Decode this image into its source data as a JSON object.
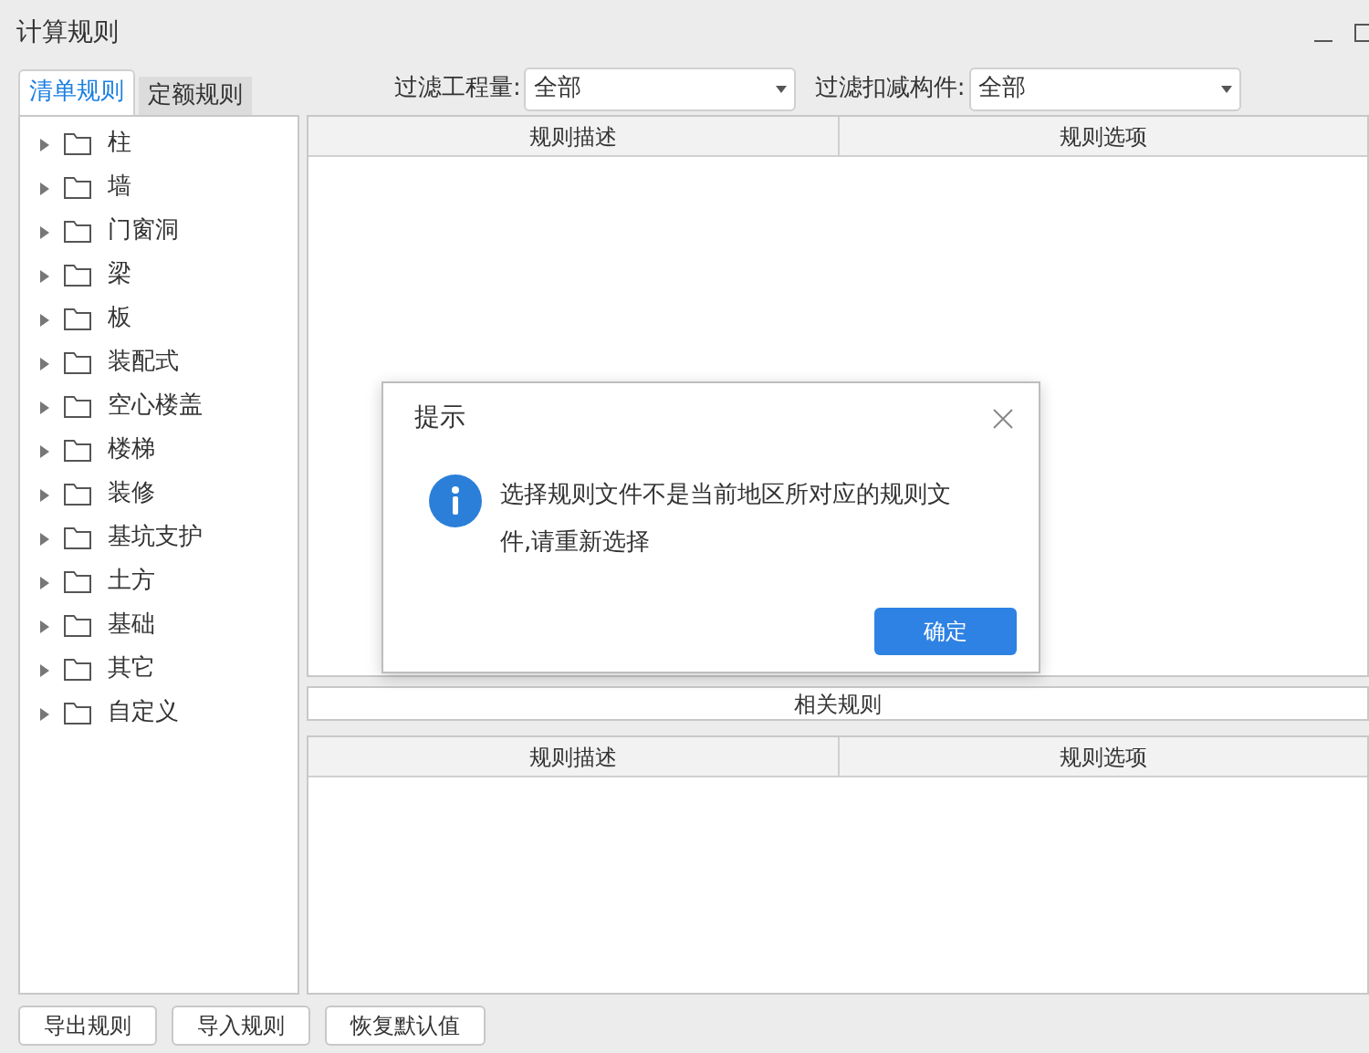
{
  "window": {
    "title": "计算规则"
  },
  "tabs": [
    {
      "label": "清单规则",
      "selected": true
    },
    {
      "label": "定额规则",
      "selected": false
    }
  ],
  "filters": [
    {
      "label": "过滤工程量:",
      "value": "全部"
    },
    {
      "label": "过滤扣减构件:",
      "value": "全部"
    }
  ],
  "tree": {
    "items": [
      {
        "label": "柱",
        "expanded": false
      },
      {
        "label": "墙",
        "expanded": false
      },
      {
        "label": "门窗洞",
        "expanded": false
      },
      {
        "label": "梁",
        "expanded": false
      },
      {
        "label": "板",
        "expanded": false
      },
      {
        "label": "装配式",
        "expanded": false
      },
      {
        "label": "空心楼盖",
        "expanded": false
      },
      {
        "label": "楼梯",
        "expanded": false
      },
      {
        "label": "装修",
        "expanded": false
      },
      {
        "label": "基坑支护",
        "expanded": false
      },
      {
        "label": "土方",
        "expanded": false
      },
      {
        "label": "基础",
        "expanded": false
      },
      {
        "label": "其它",
        "expanded": false
      },
      {
        "label": "自定义",
        "expanded": false
      }
    ]
  },
  "rules_table": {
    "columns": [
      "规则描述",
      "规则选项"
    ]
  },
  "related_rules": {
    "title": "相关规则",
    "columns": [
      "规则描述",
      "规则选项"
    ]
  },
  "buttons": [
    "导出规则",
    "导入规则",
    "恢复默认值"
  ],
  "dialog": {
    "title": "提示",
    "message": "选择规则文件不是当前地区所对应的规则文件,请重新选择",
    "ok": "确定"
  }
}
